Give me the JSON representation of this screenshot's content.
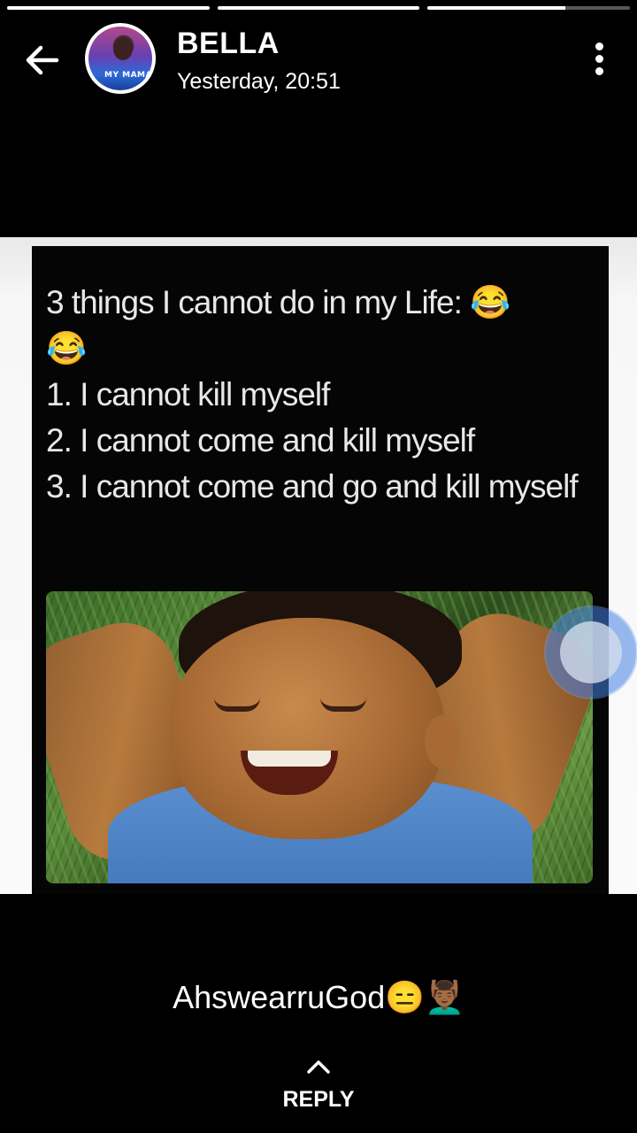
{
  "story": {
    "progress": [
      1.0,
      1.0,
      0.68
    ],
    "sender_name": "BELLA",
    "timestamp": "Yesterday, 20:51",
    "avatar_text": "MY MAMA"
  },
  "image": {
    "meme_text": "3 things I cannot do in my Life: 😂\n😂\n1. I cannot kill myself\n2. I cannot come and kill myself\n3. I cannot come and go and kill myself"
  },
  "caption": "AhswearruGod😑💆🏾‍♂️",
  "reply": {
    "label": "REPLY"
  },
  "icons": {
    "back": "arrow-left-icon",
    "menu": "more-vertical-icon",
    "reply": "chevron-up-icon"
  },
  "colors": {
    "background": "#000000",
    "text": "#ffffff",
    "touch_indicator": "#4682e6"
  }
}
